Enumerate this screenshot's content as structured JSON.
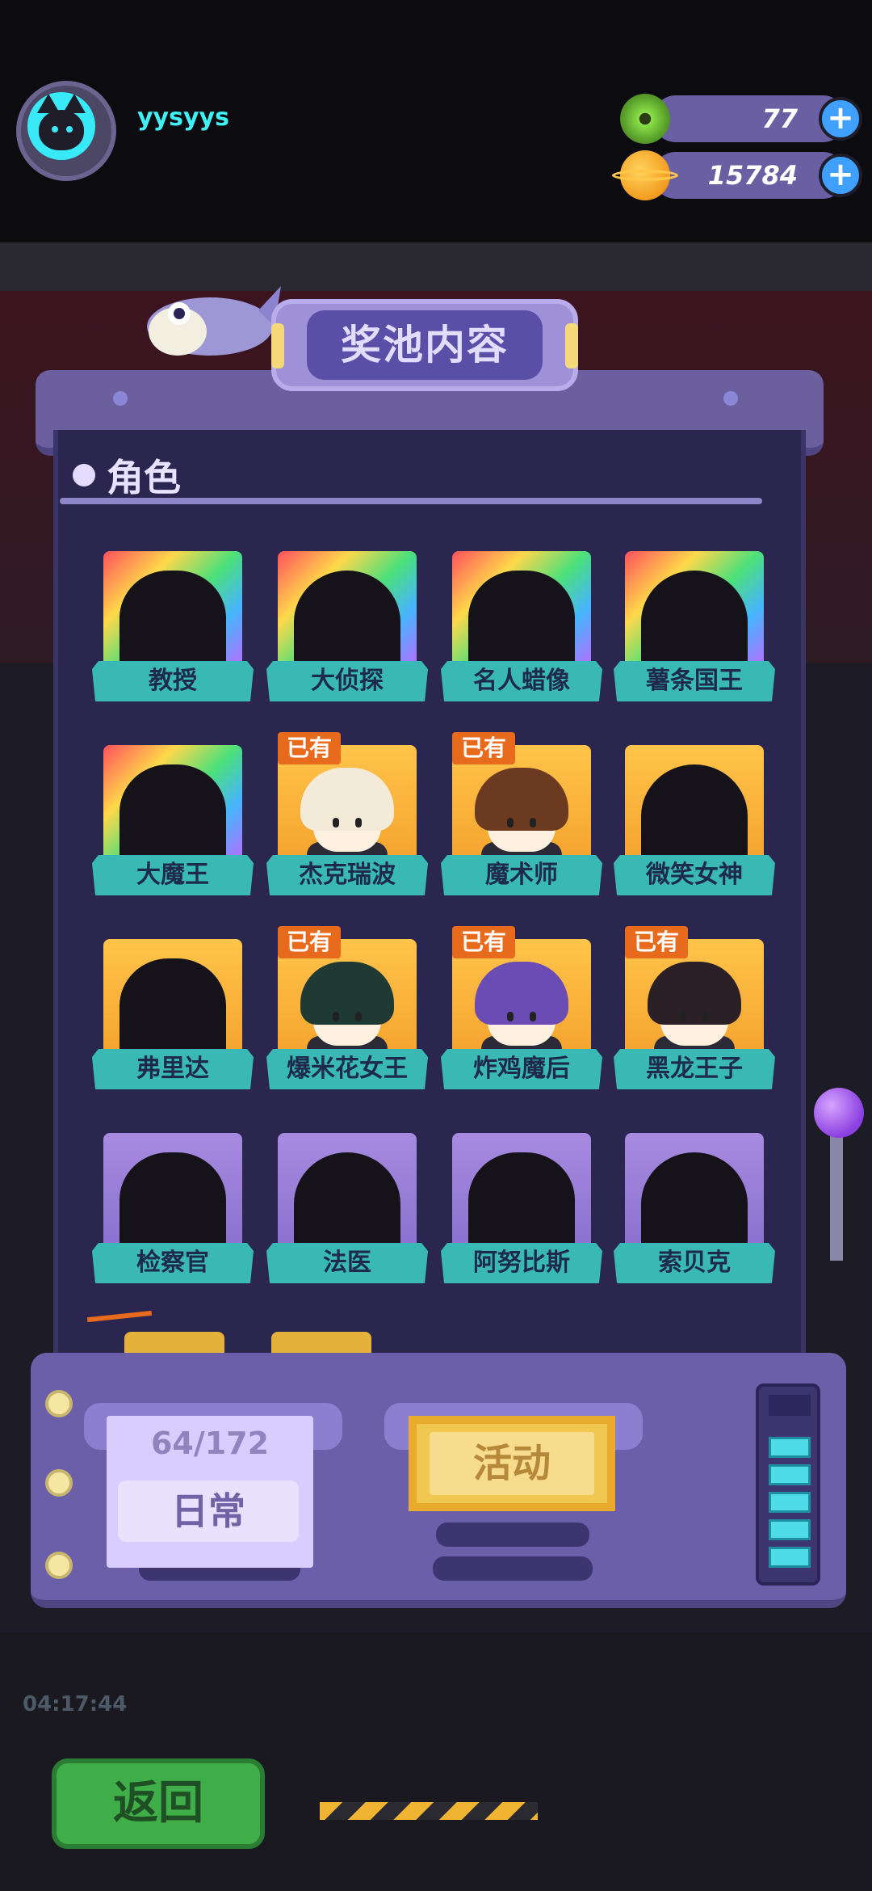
{
  "hud": {
    "username": "yysyys",
    "gems": "77",
    "coins": "15784"
  },
  "title": "奖池内容",
  "section": "角色",
  "characters": [
    {
      "name": "教授",
      "rarity": "rainbow",
      "owned": false
    },
    {
      "name": "大侦探",
      "rarity": "rainbow",
      "owned": false
    },
    {
      "name": "名人蜡像",
      "rarity": "rainbow",
      "owned": false
    },
    {
      "name": "薯条国王",
      "rarity": "rainbow",
      "owned": false
    },
    {
      "name": "大魔王",
      "rarity": "rainbow",
      "owned": false
    },
    {
      "name": "杰克瑞波",
      "rarity": "gold",
      "owned": true
    },
    {
      "name": "魔术师",
      "rarity": "gold",
      "owned": true
    },
    {
      "name": "微笑女神",
      "rarity": "gold",
      "owned": false
    },
    {
      "name": "弗里达",
      "rarity": "gold",
      "owned": false
    },
    {
      "name": "爆米花女王",
      "rarity": "gold",
      "owned": true
    },
    {
      "name": "炸鸡魔后",
      "rarity": "gold",
      "owned": true
    },
    {
      "name": "黑龙王子",
      "rarity": "gold",
      "owned": true
    },
    {
      "name": "检察官",
      "rarity": "purple",
      "owned": false
    },
    {
      "name": "法医",
      "rarity": "purple",
      "owned": false
    },
    {
      "name": "阿努比斯",
      "rarity": "purple",
      "owned": false
    },
    {
      "name": "索贝克",
      "rarity": "purple",
      "owned": false
    }
  ],
  "owned_label": "已有",
  "machine": {
    "progress": "64/172",
    "daily_label": "日常",
    "event_label": "活动"
  },
  "back_label": "返回",
  "timer": "04:17:44",
  "colors": {
    "panel": "#2a2650",
    "ribbon": "#3ab8b6",
    "owned_badge": "#e86a1c",
    "username": "#3ff0f4"
  }
}
